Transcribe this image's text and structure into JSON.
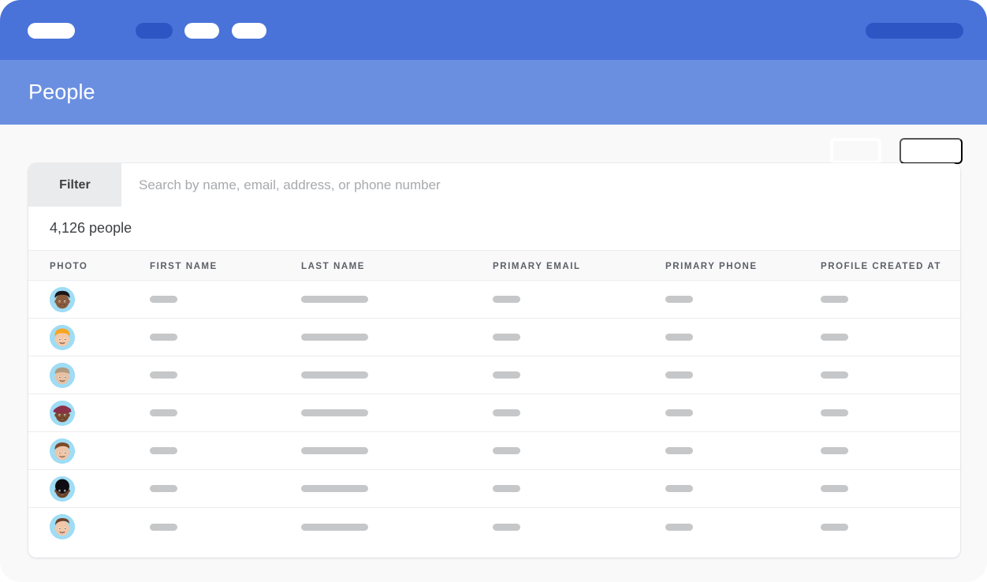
{
  "window": {
    "background": "#f9f9fa",
    "nav_color": "#4a73d9",
    "header_color": "#6b8fe0",
    "accent_dark": "#2e55c4"
  },
  "top_nav": {
    "logo": "",
    "items": [
      {
        "name": "nav-item-1",
        "label": "",
        "active": true
      },
      {
        "name": "nav-item-2",
        "label": "",
        "active": false
      },
      {
        "name": "nav-item-3",
        "label": "",
        "active": false
      }
    ],
    "account": {
      "label": ""
    }
  },
  "header": {
    "title": "People",
    "secondary_button_label": "",
    "primary_button_label": ""
  },
  "filter_bar": {
    "filter_tab_label": "Filter",
    "search_value": "",
    "search_placeholder": "Search by name, email, address, or phone number"
  },
  "summary": {
    "count_label": "4,126 people"
  },
  "table": {
    "columns": [
      {
        "key": "photo",
        "label": "Photo"
      },
      {
        "key": "first",
        "label": "First Name"
      },
      {
        "key": "last",
        "label": "Last Name"
      },
      {
        "key": "email",
        "label": "Primary Email"
      },
      {
        "key": "phone",
        "label": "Primary Phone"
      },
      {
        "key": "created",
        "label": "Profile Created At"
      }
    ],
    "rows": [
      {
        "avatar": "avatar-dark-short-hair",
        "first": "",
        "last": "",
        "email": "",
        "phone": "",
        "created": ""
      },
      {
        "avatar": "avatar-blond-wavy-hair",
        "first": "",
        "last": "",
        "email": "",
        "phone": "",
        "created": ""
      },
      {
        "avatar": "avatar-light-brown-hair",
        "first": "",
        "last": "",
        "email": "",
        "phone": "",
        "created": ""
      },
      {
        "avatar": "avatar-woman-burgundy-hat",
        "first": "",
        "last": "",
        "email": "",
        "phone": "",
        "created": ""
      },
      {
        "avatar": "avatar-brown-swept-hair",
        "first": "",
        "last": "",
        "email": "",
        "phone": "",
        "created": ""
      },
      {
        "avatar": "avatar-black-afro-hair",
        "first": "",
        "last": "",
        "email": "",
        "phone": "",
        "created": ""
      },
      {
        "avatar": "avatar-brown-quiff-hair",
        "first": "",
        "last": "",
        "email": "",
        "phone": "",
        "created": ""
      }
    ],
    "skeleton_color": "#c6c7c9",
    "avatar_background": "#9fdcf5"
  }
}
